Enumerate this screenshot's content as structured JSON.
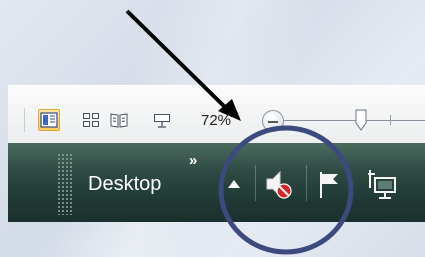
{
  "status_bar": {
    "view_buttons": [
      {
        "name": "normal-view",
        "icon": "normal-view-icon",
        "active": true
      },
      {
        "name": "slide-sorter-view",
        "icon": "slide-sorter-icon",
        "active": false
      },
      {
        "name": "reading-view",
        "icon": "reading-view-icon",
        "active": false
      },
      {
        "name": "slide-show-view",
        "icon": "slide-show-icon",
        "active": false
      }
    ],
    "zoom_percent": "72%",
    "zoom_level": 0.72
  },
  "taskbar": {
    "toolbar_label": "Desktop",
    "overflow_chevrons": "»",
    "tray_icons": [
      {
        "name": "show-hidden-icons-arrow",
        "icon": "triangle-up-icon"
      },
      {
        "name": "volume-muted-icon",
        "icon": "speaker-muted-icon"
      },
      {
        "name": "action-center-icon",
        "icon": "flag-icon"
      },
      {
        "name": "network-icon",
        "icon": "network-computer-icon"
      }
    ]
  },
  "annotation": {
    "arrow_color": "#000000",
    "circle_color": "#3c4a7d"
  },
  "colors": {
    "taskbar": "#2f4b44",
    "active_view_button": "#ffd15c",
    "muted_badge": "#d8232a"
  }
}
